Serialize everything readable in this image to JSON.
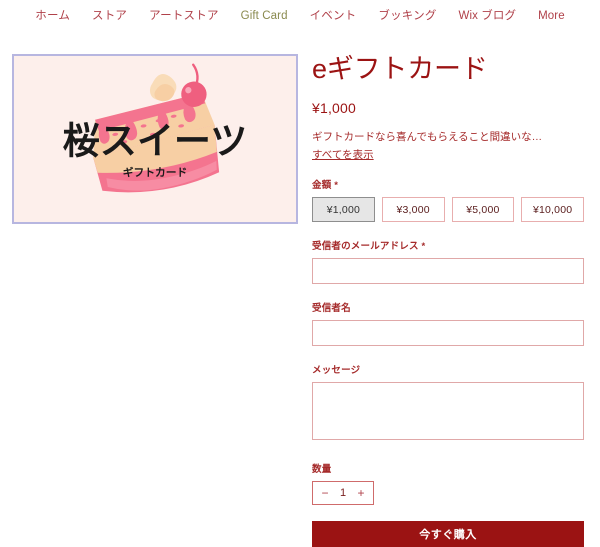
{
  "nav": {
    "items": [
      {
        "label": "ホーム",
        "current": false,
        "latin": false
      },
      {
        "label": "ストア",
        "current": false,
        "latin": false
      },
      {
        "label": "アートストア",
        "current": false,
        "latin": false
      },
      {
        "label": "Gift Card",
        "current": true,
        "latin": true
      },
      {
        "label": "イベント",
        "current": false,
        "latin": false
      },
      {
        "label": "ブッキング",
        "current": false,
        "latin": false
      },
      {
        "label": "Wix ブログ",
        "current": false,
        "latin": true
      },
      {
        "label": "More",
        "current": false,
        "latin": true
      }
    ]
  },
  "gallery": {
    "image_alt": "桜スイーツ ギフトカード",
    "card_brand_text": "桜スイーツ",
    "card_sub_text": "ギフトカード",
    "colors": {
      "background": "#fdefeb",
      "selection_border": "#b7b6e0",
      "cake_body": "#f7cfa4",
      "cake_icing": "#f4748f",
      "cherry": "#ef5f7f",
      "cream": "#f9dcb8"
    }
  },
  "product": {
    "title": "eギフトカード",
    "price": "¥1,000",
    "description": "ギフトカードなら喜んでもらえること間違いな…",
    "see_all_label": "すべてを表示"
  },
  "form": {
    "amount": {
      "label": "金額 *",
      "options": [
        "¥1,000",
        "¥3,000",
        "¥5,000",
        "¥10,000"
      ],
      "selected_index": 0
    },
    "recipient_email": {
      "label": "受信者のメールアドレス *",
      "value": "",
      "placeholder": ""
    },
    "recipient_name": {
      "label": "受信者名",
      "value": "",
      "placeholder": ""
    },
    "message": {
      "label": "メッセージ",
      "value": "",
      "placeholder": ""
    },
    "quantity": {
      "label": "数量",
      "decrement_icon": "−",
      "value": "1",
      "increment_icon": "+"
    },
    "buy_label": "今すぐ購入"
  },
  "colors": {
    "nav_link": "#b0414a",
    "nav_current": "#8a8a4e",
    "title": "#9b1313",
    "accent_button": "#9b1313",
    "field_border": "#e0a8a8"
  }
}
